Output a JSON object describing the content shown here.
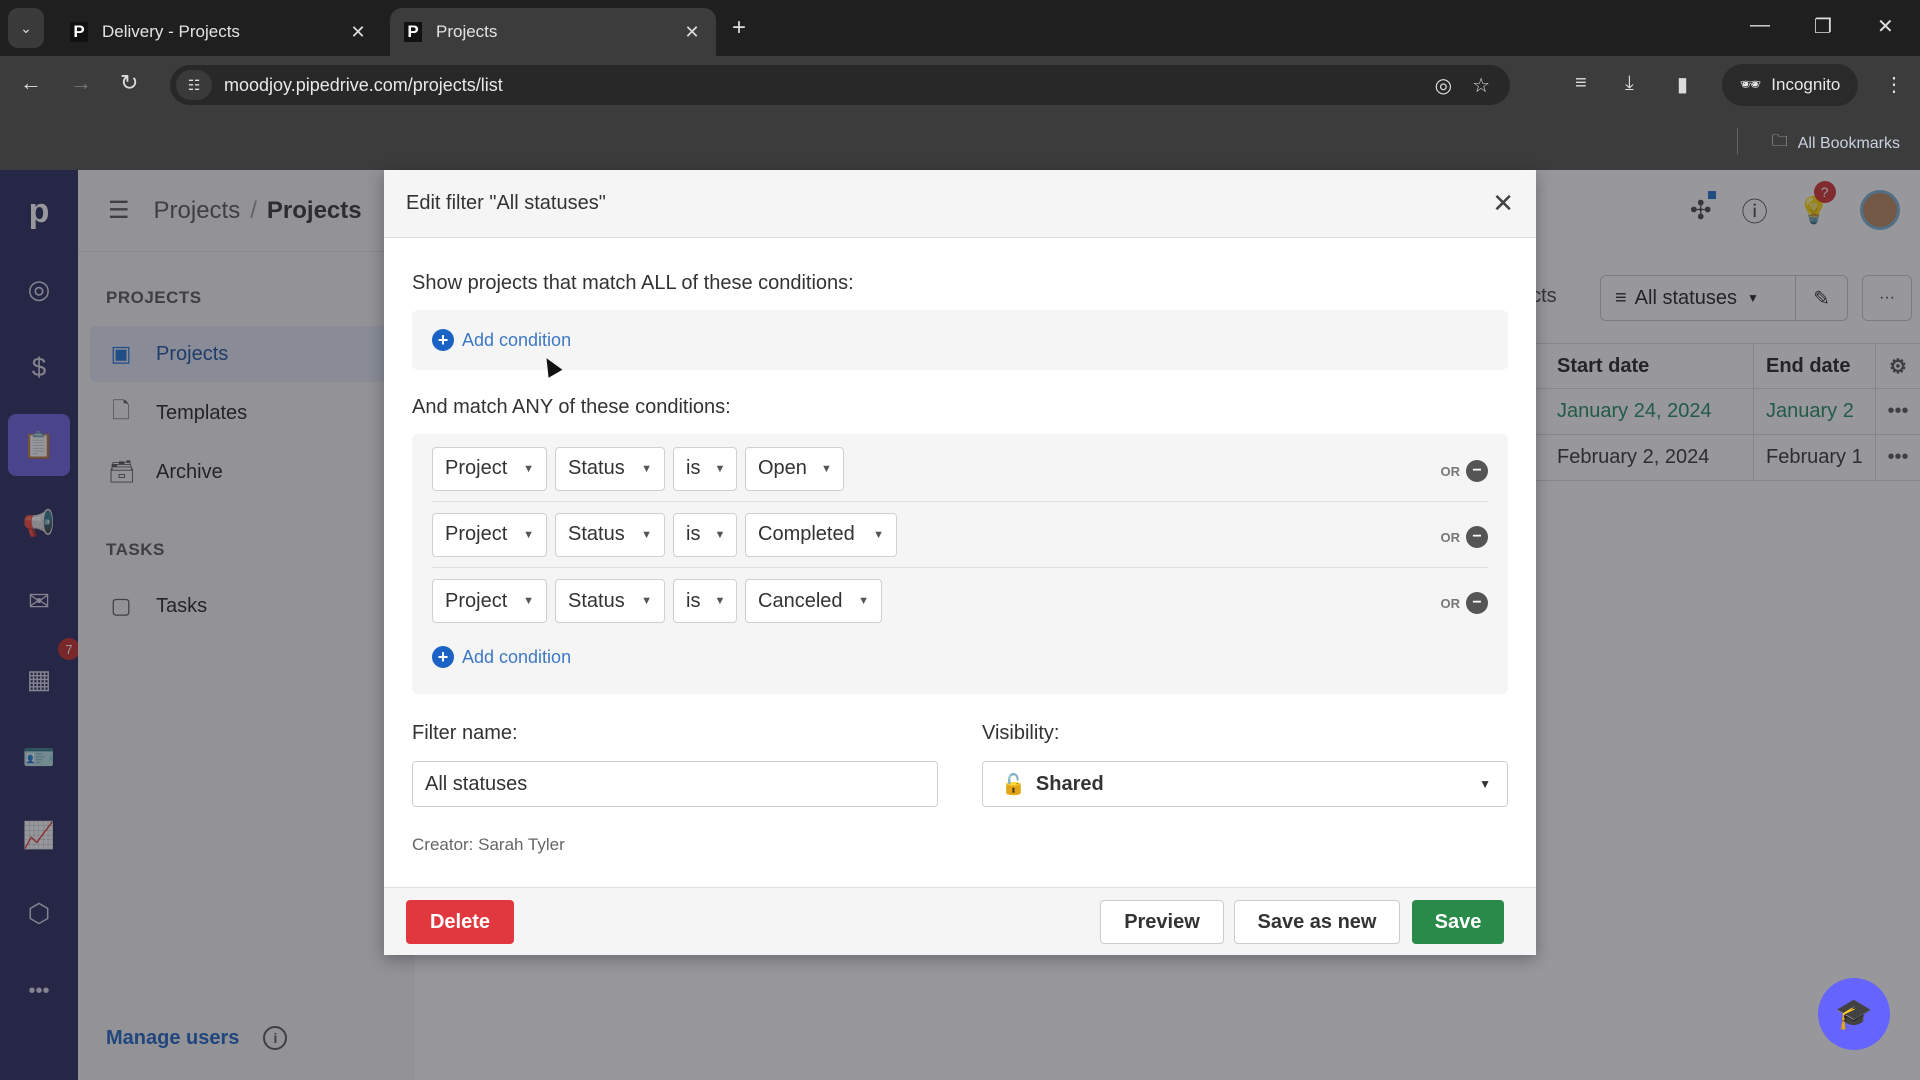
{
  "browser": {
    "tabs": [
      {
        "title": "Delivery - Projects",
        "favicon": "P",
        "active": false
      },
      {
        "title": "Projects",
        "favicon": "P",
        "active": true
      }
    ],
    "url": "moodjoy.pipedrive.com/projects/list",
    "incognito_label": "Incognito",
    "bookmarks_label": "All Bookmarks"
  },
  "leftnav": {
    "items": [
      {
        "icon": "pipedrive-logo"
      },
      {
        "icon": "target-icon"
      },
      {
        "icon": "dollar-icon"
      },
      {
        "icon": "projects-icon",
        "active": true
      },
      {
        "icon": "megaphone-icon"
      },
      {
        "icon": "mail-icon"
      },
      {
        "icon": "calendar-icon",
        "badge": "7"
      },
      {
        "icon": "contacts-icon"
      },
      {
        "icon": "chart-icon"
      },
      {
        "icon": "box-icon"
      },
      {
        "icon": "more-icon"
      }
    ]
  },
  "sidebar": {
    "breadcrumb": [
      "Projects",
      "Projects"
    ],
    "sections": [
      {
        "title": "PROJECTS",
        "items": [
          {
            "label": "Projects",
            "active": true
          },
          {
            "label": "Templates"
          },
          {
            "label": "Archive"
          }
        ]
      },
      {
        "title": "TASKS",
        "items": [
          {
            "label": "Tasks"
          }
        ]
      }
    ],
    "manage_users": "Manage users"
  },
  "main": {
    "partial_label": "ects",
    "filter_label": "All statuses",
    "lightbulb_badge": "?",
    "table": {
      "headers": [
        "Start date",
        "End date"
      ],
      "rows": [
        [
          "January 24, 2024",
          "January 2"
        ],
        [
          "February 2, 2024",
          "February 1"
        ]
      ]
    }
  },
  "modal": {
    "title": "Edit filter \"All statuses\"",
    "all_label": "Show projects that match ALL of these conditions:",
    "add_condition": "Add condition",
    "any_label": "And match ANY of these conditions:",
    "any_conditions": [
      {
        "entity": "Project",
        "field": "Status",
        "operator": "is",
        "value": "Open"
      },
      {
        "entity": "Project",
        "field": "Status",
        "operator": "is",
        "value": "Completed"
      },
      {
        "entity": "Project",
        "field": "Status",
        "operator": "is",
        "value": "Canceled"
      }
    ],
    "or_label": "OR",
    "filter_name_label": "Filter name:",
    "filter_name_value": "All statuses",
    "visibility_label": "Visibility:",
    "visibility_value": "Shared",
    "creator": "Creator: Sarah Tyler",
    "buttons": {
      "delete": "Delete",
      "preview": "Preview",
      "save_as_new": "Save as new",
      "save": "Save"
    }
  }
}
